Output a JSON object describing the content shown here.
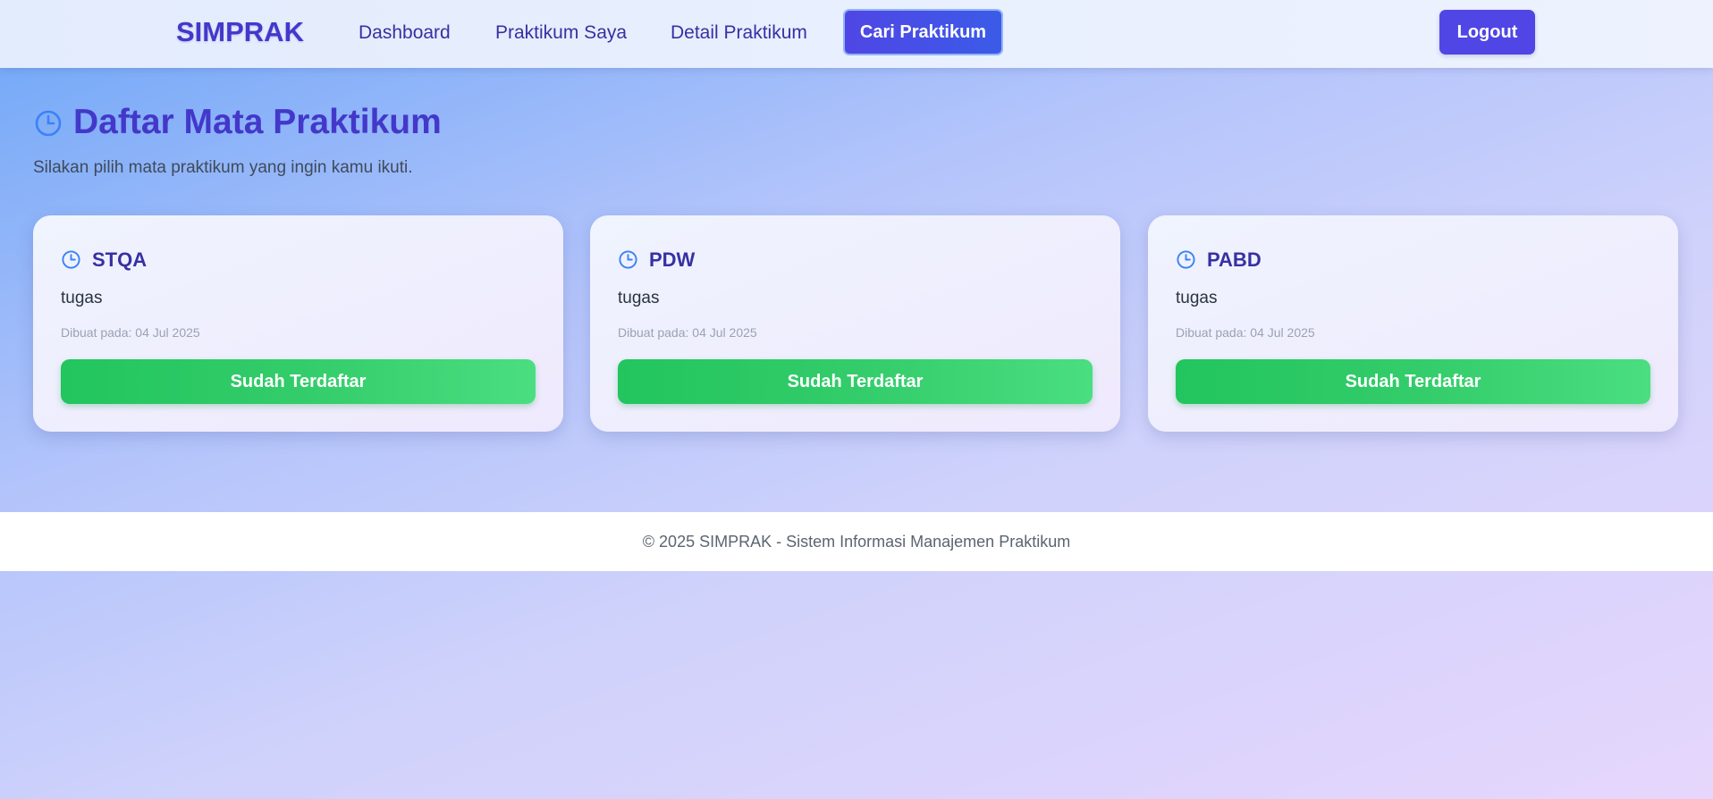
{
  "nav": {
    "brand": "SIMPRAK",
    "links": [
      "Dashboard",
      "Praktikum Saya",
      "Detail Praktikum"
    ],
    "active": "Cari Praktikum",
    "logout": "Logout"
  },
  "header": {
    "icon": "clock-icon",
    "title": "Daftar Mata Praktikum",
    "subtitle": "Silakan pilih mata praktikum yang ingin kamu ikuti."
  },
  "courses": [
    {
      "icon": "clock-icon",
      "name": "STQA",
      "description": "tugas",
      "created": "Dibuat pada: 04 Jul 2025",
      "button": "Sudah Terdaftar"
    },
    {
      "icon": "clock-icon",
      "name": "PDW",
      "description": "tugas",
      "created": "Dibuat pada: 04 Jul 2025",
      "button": "Sudah Terdaftar"
    },
    {
      "icon": "clock-icon",
      "name": "PABD",
      "description": "tugas",
      "created": "Dibuat pada: 04 Jul 2025",
      "button": "Sudah Terdaftar"
    }
  ],
  "footer": {
    "text": "© 2025 SIMPRAK - Sistem Informasi Manajemen Praktikum"
  },
  "colors": {
    "brand": "#4338ca",
    "active_nav": "#4f46e5",
    "success": "#22c55e",
    "icon": "#3b82f6"
  }
}
